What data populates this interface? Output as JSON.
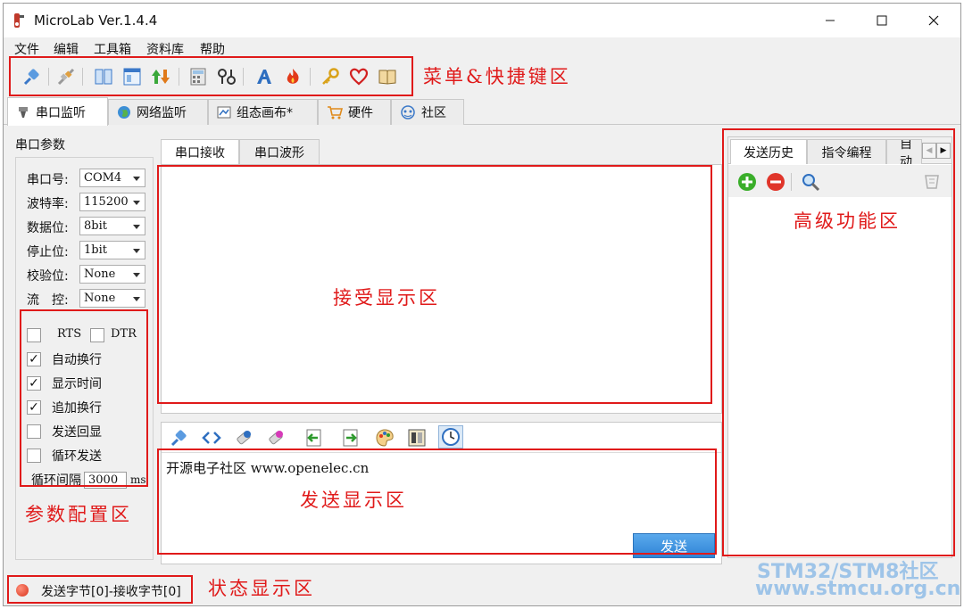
{
  "window": {
    "title": "MicroLab Ver.1.4.4"
  },
  "menu": [
    "文件",
    "编辑",
    "工具箱",
    "资料库",
    "帮助"
  ],
  "main_tabs": [
    {
      "label": "串口监听",
      "icon": "usb-plug-icon",
      "active": true
    },
    {
      "label": "网络监听",
      "icon": "globe-icon",
      "active": false
    },
    {
      "label": "组态画布*",
      "icon": "canvas-icon",
      "active": false
    },
    {
      "label": "硬件",
      "icon": "cart-icon",
      "active": false
    },
    {
      "label": "社区",
      "icon": "community-icon",
      "active": false
    }
  ],
  "serial_params": {
    "title": "串口参数",
    "port": {
      "label": "串口号:",
      "value": "COM4"
    },
    "baud": {
      "label": "波特率:",
      "value": "115200"
    },
    "databits": {
      "label": "数据位:",
      "value": "8bit"
    },
    "stopbits": {
      "label": "停止位:",
      "value": "1bit"
    },
    "parity": {
      "label": "校验位:",
      "value": "None"
    },
    "flow": {
      "label": "流　控:",
      "value": "None"
    }
  },
  "options": {
    "rts": {
      "label": "RTS",
      "checked": false
    },
    "dtr": {
      "label": "DTR",
      "checked": false
    },
    "auto_wrap": {
      "label": "自动换行",
      "checked": true
    },
    "show_time": {
      "label": "显示时间",
      "checked": true
    },
    "append_newline": {
      "label": "追加换行",
      "checked": true
    },
    "echo_send": {
      "label": "发送回显",
      "checked": false
    },
    "loop_send": {
      "label": "循环发送",
      "checked": false
    },
    "interval": {
      "label": "循环间隔",
      "value": "3000",
      "unit": "ms"
    }
  },
  "receive_tabs": [
    "串口接收",
    "串口波形"
  ],
  "send": {
    "text": "开源电子社区 www.openelec.cn",
    "button": "发送"
  },
  "right_tabs": [
    "发送历史",
    "指令编程",
    "自动"
  ],
  "status": {
    "text": "发送字节[0]-接收字节[0]"
  },
  "annotations": {
    "menu_area": "菜单&快捷键区",
    "advanced_area": "高级功能区",
    "receive_area": "接受显示区",
    "send_area": "发送显示区",
    "param_area": "参数配置区",
    "status_area": "状态显示区"
  },
  "watermark": {
    "line1": "STM32/STM8社区",
    "line2": "www.stmcu.org.cn"
  },
  "colors": {
    "annotation": "#e01a1a",
    "send_button": "#3a8fe0",
    "watermark": "#9ec4e8"
  }
}
